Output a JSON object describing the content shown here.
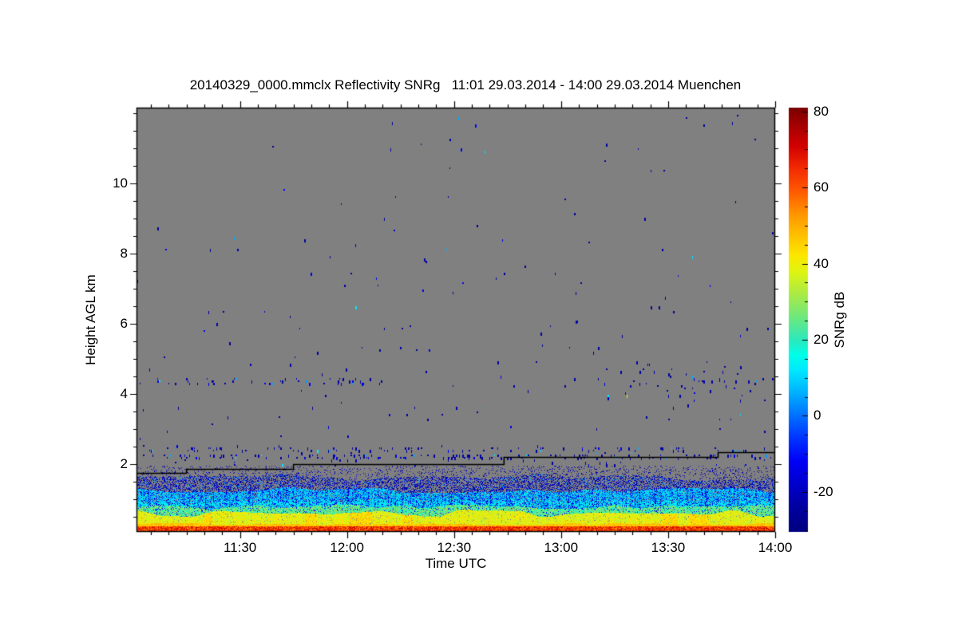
{
  "chart_data": {
    "type": "heatmap",
    "title": "20140329_0000.mmclx Reflectivity SNRg   11:01 29.03.2014 - 14:00 29.03.2014 Muenchen",
    "xlabel": "Time UTC",
    "ylabel": "Height AGL km",
    "x_start": "11:01",
    "x_end": "14:00",
    "x_total_minutes": 179,
    "x_tick_labels": [
      "11:30",
      "12:00",
      "12:30",
      "13:00",
      "13:30",
      "14:00"
    ],
    "x_tick_minutes": [
      29,
      59,
      89,
      119,
      149,
      179
    ],
    "x_minor_step_minutes": 5,
    "y_range_km": [
      0.07,
      12.16
    ],
    "y_tick_labels": [
      "2",
      "4",
      "6",
      "8",
      "10"
    ],
    "y_tick_km": [
      2,
      4,
      6,
      8,
      10
    ],
    "y_minor_step_km": 0.5,
    "grid": false,
    "no_signal_color": "#808080",
    "frame_color": "#000000",
    "colorbar": {
      "label": "SNRg dB",
      "tick_values": [
        80,
        60,
        40,
        20,
        0,
        -20
      ],
      "minor_step_db": 5,
      "range_db": [
        -30.5,
        81
      ]
    },
    "palette": [
      [
        -30.5,
        "#000080"
      ],
      [
        -24,
        "#0000a0"
      ],
      [
        -18,
        "#0000cd"
      ],
      [
        -12,
        "#0000f5"
      ],
      [
        -6,
        "#0032ff"
      ],
      [
        0,
        "#0070ff"
      ],
      [
        6,
        "#00b0ff"
      ],
      [
        12,
        "#00e8ff"
      ],
      [
        16,
        "#00ffe8"
      ],
      [
        20,
        "#2de8bc"
      ],
      [
        26,
        "#6fe87d"
      ],
      [
        32,
        "#aaeb46"
      ],
      [
        38,
        "#e0f510"
      ],
      [
        42,
        "#fce800"
      ],
      [
        47,
        "#ffc400"
      ],
      [
        53,
        "#ff9600"
      ],
      [
        59,
        "#ff5a00"
      ],
      [
        65,
        "#f32b00"
      ],
      [
        71,
        "#d20000"
      ],
      [
        76,
        "#a80000"
      ],
      [
        81,
        "#7a0000"
      ]
    ],
    "cloud_base_line": {
      "color": "#000000",
      "steps_min_km": [
        [
          0,
          14,
          1.75
        ],
        [
          14,
          44,
          1.86
        ],
        [
          44,
          103,
          2.0
        ],
        [
          103,
          163,
          2.2
        ],
        [
          163,
          179,
          2.34
        ]
      ]
    },
    "boundary_layer_texture": {
      "blue_top_km": [
        1.52,
        0.25
      ],
      "cyan_top_km": [
        1.18,
        0.2
      ],
      "green_top_km": [
        0.72,
        0.15
      ],
      "yellow_top_km": [
        0.5,
        0.22
      ],
      "orange_top_km": [
        0.28,
        0.06
      ],
      "surface_top_km": 0.235,
      "bright_stripe_km": [
        0.8,
        0.95
      ],
      "streak_fraction": 0.16,
      "zone_values_db": {
        "surface": [
          52,
          72
        ],
        "surface_dash": [
          66,
          76
        ],
        "orange": [
          42,
          52
        ],
        "yellow": [
          33,
          44
        ],
        "green": [
          16,
          32
        ],
        "cyan": [
          0,
          16
        ],
        "blue_mix": [
          -24,
          -6
        ],
        "dark_speckle": [
          -26,
          -16
        ]
      }
    },
    "noise_speckles": {
      "value_db_choices": [
        -24,
        -14,
        5,
        12
      ],
      "density_below_2p6km": 0.012,
      "density_2p6_6km": 0.0045,
      "density_6_9km": 0.0028,
      "density_above_9km": 0.0015,
      "row_features_km": [
        [
          2.25,
          0.045,
          0.2
        ],
        [
          2.44,
          0.04,
          0.13
        ]
      ],
      "band_feature": {
        "km": [
          4.28,
          4.46
        ],
        "minutes": [
          0,
          69
        ],
        "density": 0.11
      },
      "cluster_feature": {
        "km": [
          3.8,
          5.0
        ],
        "minutes": [
          128,
          172
        ],
        "density": 0.02
      },
      "cluster_feature2": {
        "km": [
          4.2,
          4.6
        ],
        "minutes": [
          128,
          176
        ],
        "density": 0.035
      },
      "above_line_density": 0.05,
      "bright_speck": {
        "minute": 137.3,
        "km": 3.98,
        "value_db": 40
      }
    },
    "features": [
      "strong surface clutter line 45-75 dB at 0-0.25 km across full time range",
      "boundary-layer echo band up to ~1.6 km (cyan/green/yellow/orange)",
      "stepped black cloud-base/plate line rising 1.75 to 2.34 km",
      "sparse blue noise speckles scattered up to 12 km",
      "denser speckle row near 4.35 km before 12:10 and cluster 13:10-13:50 near 4-5 km"
    ]
  }
}
